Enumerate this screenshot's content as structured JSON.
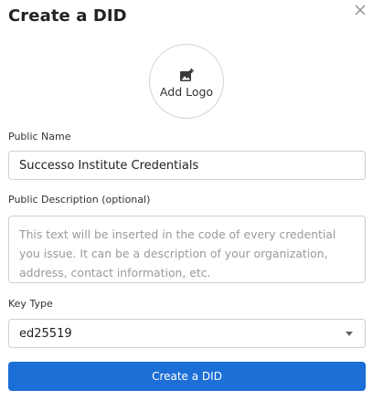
{
  "dialog": {
    "title": "Create a DID",
    "close_icon": "close-icon"
  },
  "logo": {
    "icon": "add-image-icon",
    "label": "Add Logo"
  },
  "public_name": {
    "label": "Public Name",
    "value": "Successo Institute Credentials"
  },
  "public_description": {
    "label": "Public Description (optional)",
    "placeholder": "This text will be inserted in the code of every credential you issue. It can be a description of your organization, address, contact information, etc."
  },
  "key_type": {
    "label": "Key Type",
    "value": "ed25519",
    "icon": "chevron-down-icon"
  },
  "submit": {
    "label": "Create a DID"
  },
  "colors": {
    "primary": "#1c6fd6"
  }
}
